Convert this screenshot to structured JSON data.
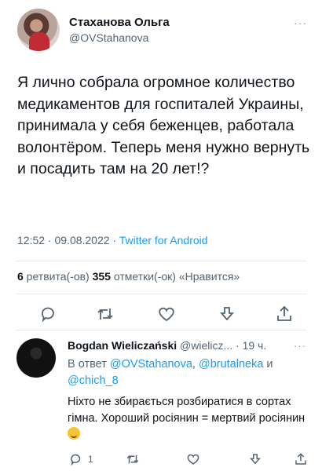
{
  "tweet": {
    "author_name": "Стаханова Ольга",
    "author_handle": "@OVStahanova",
    "more_label": "···",
    "text": "Я лично собрала огромное количество медикаментов для госпиталей Украины, принимала у себя беженцев, работала волонтёром. Теперь меня нужно вернуть и посадить там на 20 лет!?",
    "timestamp": "12:52 · 09.08.2022 · ",
    "source": "Twitter for Android",
    "retweets_count": "6",
    "retweets_label": " ретвита(-ов)  ",
    "likes_count": "355",
    "likes_label": " отметки(-ок) «Нравится»",
    "icons": [
      "reply-icon",
      "retweet-icon",
      "like-icon",
      "share-icon",
      "upload-icon"
    ]
  },
  "reply": {
    "author_name": "Bogdan Wieliczański",
    "author_handle": " @wielicz... · 19 ч.",
    "more_label": "···",
    "reply_prefix": "В ответ ",
    "mention_1": "@OVStahanova",
    "sep_1": ", ",
    "mention_2": "@brutalneka",
    "sep_2": " и ",
    "mention_3": "@chich_8",
    "text": "Ніхто не збирається розбиратися в сортах гімна. Хороший росіянин = мертвий росіянин ",
    "emoji": "grinning-sweat-emoji",
    "reply_count": "1"
  },
  "colors": {
    "accent": "#1d9bf0",
    "secondary_text": "#536471",
    "primary_text": "#0f1419"
  }
}
